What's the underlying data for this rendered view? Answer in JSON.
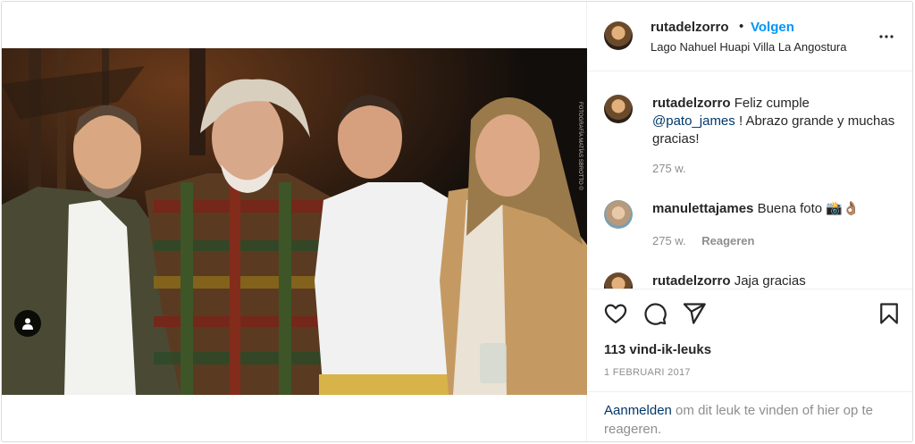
{
  "post": {
    "username": "rutadelzorro",
    "separator": "•",
    "follow_label": "Volgen",
    "location": "Lago Nahuel Huapi Villa La Angostura",
    "photo_watermark": "FOTOGRAFÍA MATÍAS SBROTTO ©"
  },
  "comments": [
    {
      "username": "rutadelzorro",
      "text_before": "Feliz cumple",
      "mention": "@pato_james",
      "text_after": "! Abrazo grande y muchas gracias!",
      "age": "275 w."
    },
    {
      "username": "manulettajames",
      "text": "Buena foto 📸👌🏽",
      "age": "275 w.",
      "reply_label": "Reageren"
    },
    {
      "username": "rutadelzorro",
      "text": "Jaja gracias"
    }
  ],
  "actions": {
    "icons": [
      "heart-icon",
      "comment-icon",
      "share-icon",
      "bookmark-icon"
    ]
  },
  "likes_text": "113 vind-ik-leuks",
  "date_text": "1 FEBRUARI 2017",
  "login_prompt": {
    "link": "Aanmelden",
    "text": " om dit leuk te vinden of hier op te reageren."
  },
  "colors": {
    "follow_blue": "#0095f6",
    "link_navy": "#00376b",
    "muted": "#8e8e8e",
    "text": "#262626"
  }
}
